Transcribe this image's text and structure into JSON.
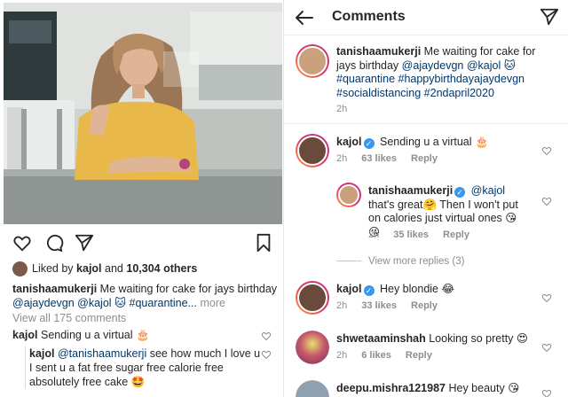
{
  "post": {
    "likes_prefix": "Liked by",
    "liker": "kajol",
    "likes_and": "and",
    "likes_count": "10,304 others",
    "caption_user": "tanishaamukerji",
    "caption_text": "Me waiting for cake for jays birthday",
    "caption_tags": "@ajaydevgn @kajol 🐱 #quarantine...",
    "caption_more": "more",
    "view_all": "View all 175 comments",
    "comments": [
      {
        "user": "kajol",
        "text": "Sending u a virtual 🎂"
      },
      {
        "user": "kajol",
        "mention": "@tanishaamukerji",
        "text": "see how much I love u I sent u a fat free sugar free calorie free absolutely free cake 🤩"
      }
    ]
  },
  "comments_screen": {
    "title": "Comments",
    "caption": {
      "user": "tanishaamukerji",
      "text": "Me waiting for cake for jays birthday",
      "tags": "@ajaydevgn @kajol 🐱 #quarantine #happybirthdayajaydevgn #socialdistancing #2ndapril2020",
      "time": "2h"
    },
    "view_more": "View more replies (3)",
    "items": [
      {
        "user": "kajol",
        "verified": "✓",
        "text": "Sending u a virtual 🎂",
        "time": "2h",
        "likes": "63 likes",
        "reply": "Reply"
      },
      {
        "user": "tanishaamukerji",
        "verified": "✓",
        "mention": "@kajol",
        "text": "that's great🤗 Then I won't put on calories just virtual ones 😘😘",
        "time": "2h",
        "likes": "35 likes",
        "reply": "Reply"
      },
      {
        "user": "kajol",
        "verified": "✓",
        "text": "Hey blondie 😂",
        "time": "2h",
        "likes": "33 likes",
        "reply": "Reply"
      },
      {
        "user": "shwetaaminshah",
        "text": "Looking so pretty 😍",
        "time": "2h",
        "likes": "6 likes",
        "reply": "Reply"
      },
      {
        "user": "deepu.mishra121987",
        "text": "Hey beauty 😘"
      }
    ]
  },
  "colors": {
    "link": "#00376b",
    "muted": "#8e8e8e",
    "verified": "#3897f0",
    "dress": "#e8b94a"
  },
  "icons": [
    "heart-icon",
    "comment-icon",
    "share-icon",
    "bookmark-icon",
    "back-arrow-icon",
    "send-icon"
  ]
}
